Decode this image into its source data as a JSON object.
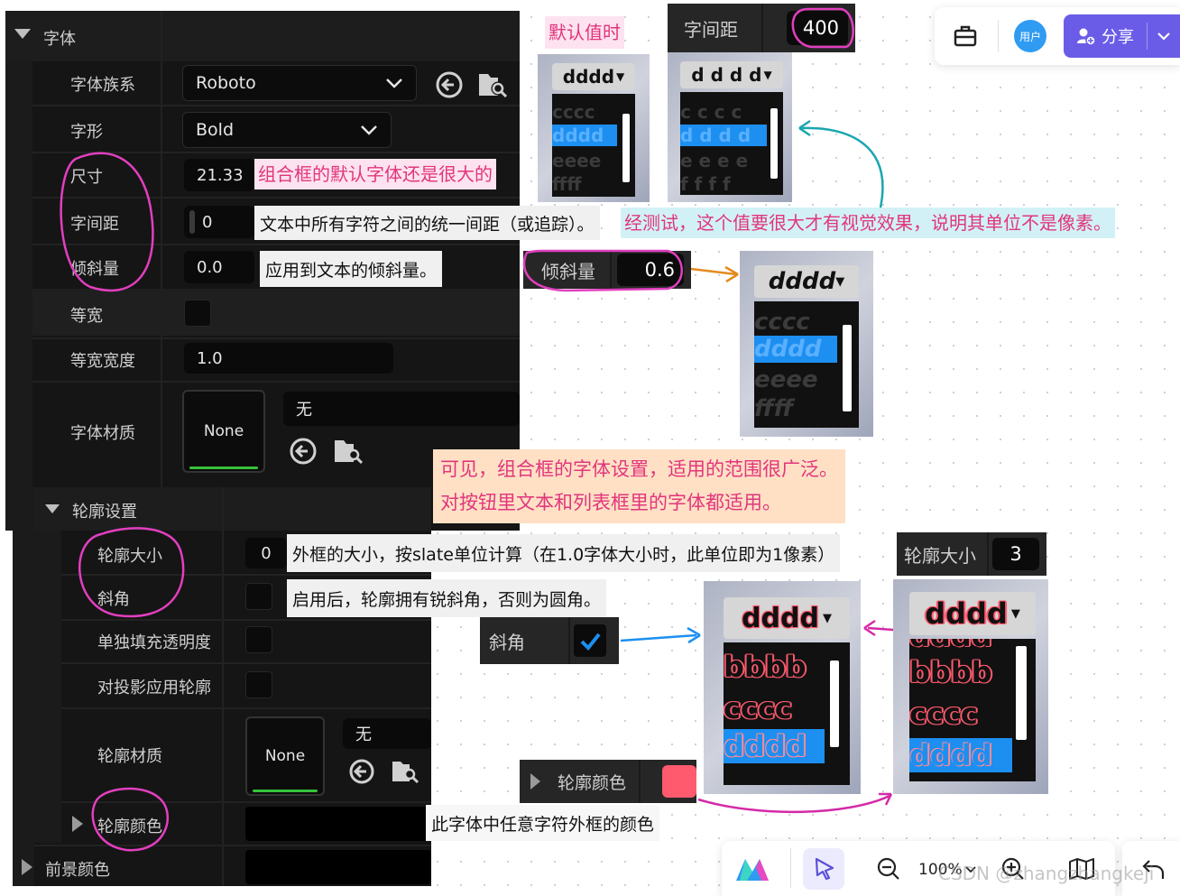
{
  "panel": {
    "font_section": "字体",
    "family_label": "字体族系",
    "family_value": "Roboto",
    "typeface_label": "字形",
    "typeface_value": "Bold",
    "size_label": "尺寸",
    "size_value": "21.33",
    "spacing_label": "字间距",
    "spacing_value": "0",
    "skew_label": "倾斜量",
    "skew_value": "0.0",
    "mono_label": "等宽",
    "mono_width_label": "等宽宽度",
    "mono_width_value": "1.0",
    "material_label": "字体材质",
    "material_tile": "None",
    "material_value": "无",
    "outline_section": "轮廓设置",
    "outline_size_label": "轮廓大小",
    "outline_size_value": "0",
    "miter_label": "斜角",
    "separate_fill_label": "单独填充透明度",
    "apply_drop_label": "对投影应用轮廓",
    "outline_material_label": "轮廓材质",
    "outline_material_tile": "None",
    "outline_material_value": "无",
    "outline_color_label": "轮廓颜色",
    "foreground_label": "前景颜色"
  },
  "notes": {
    "default_label": "默认值时",
    "size_note": "组合框的默认字体还是很大的",
    "spacing_note": "文本中所有字符之间的统一间距（或追踪）。",
    "spacing_test_note": "经测试，这个值要很大才有视觉效果，说明其单位不是像素。",
    "skew_note": "应用到文本的倾斜量。",
    "scope_note_1": "可见，组合框的字体设置，适用的范围很广泛。",
    "scope_note_2": "对按钮里文本和列表框里的字体都适用。",
    "outline_size_note": "外框的大小，按slate单位计算（在1.0字体大小时，此单位即为1像素）",
    "miter_note": "启用后，轮廓拥有锐斜角，否则为圆角。",
    "outline_color_note": "此字体中任意字符外框的颜色"
  },
  "mini": {
    "spacing_label": "字间距",
    "spacing_value": "400",
    "skew_label": "倾斜量",
    "skew_value": "0.6",
    "outline_label": "轮廓大小",
    "outline_value": "3",
    "miter_label": "斜角",
    "color_label": "轮廓颜色"
  },
  "demo_default": {
    "head": "dddd",
    "items": [
      "cccc",
      "dddd",
      "eeee",
      "ffff"
    ]
  },
  "demo_spacing": {
    "head": "d d d d",
    "items": [
      "c c c c",
      "d d d d",
      "e e e e",
      "f f f f"
    ]
  },
  "demo_skew": {
    "head": "dddd",
    "items": [
      "cccc",
      "dddd",
      "eeee",
      "ffff"
    ]
  },
  "demo_outline1": {
    "head": "dddd",
    "items": [
      "bbbb",
      "cccc",
      "dddd"
    ]
  },
  "demo_outline2": {
    "head": "dddd",
    "items": [
      "dddd",
      "bbbb",
      "cccc",
      "dddd"
    ]
  },
  "toolbar": {
    "avatar_text": "用户",
    "share_label": "分享",
    "zoom": "100%",
    "watermark": "CSDN @zhangzhangkeji"
  },
  "colors": {
    "accent": "#6b5ce7",
    "annotation_pink": "#e2357d",
    "selection_blue": "#1c8ff0",
    "outline_red": "#ff5a6e",
    "arrow_teal": "#1aa6b0",
    "arrow_orange": "#e58a1f",
    "arrow_blue": "#1c8ff0",
    "arrow_magenta": "#d42aa8"
  }
}
